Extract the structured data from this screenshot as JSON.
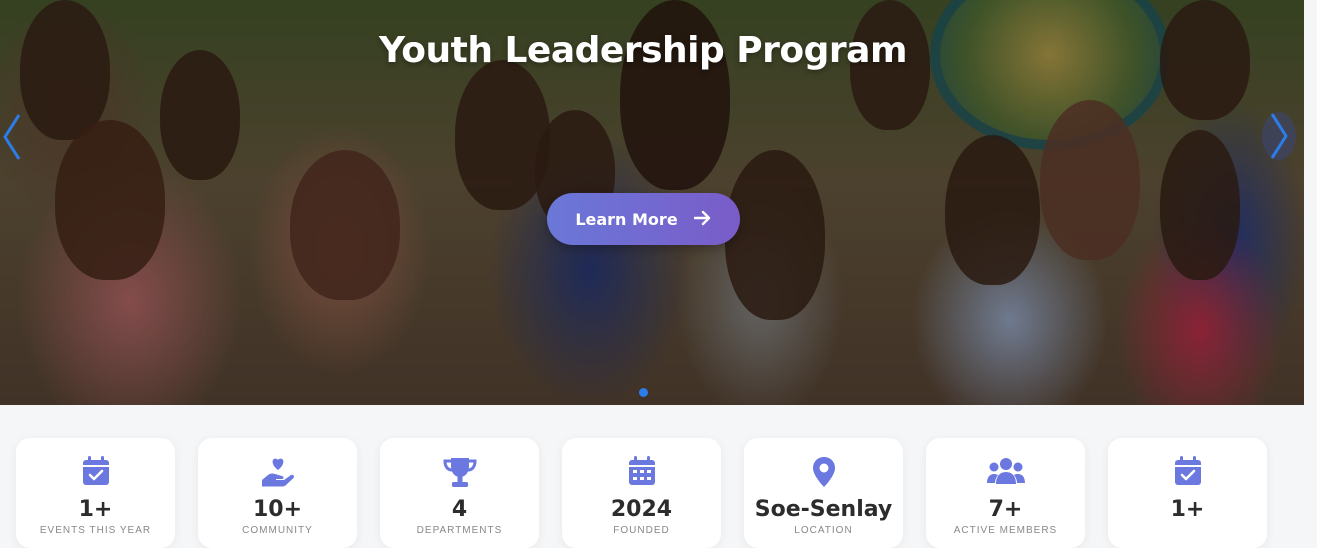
{
  "hero": {
    "title": "Youth Leadership Program",
    "cta_label": "Learn More",
    "accent": "#6a78d8",
    "dot_color": "#2b7de9"
  },
  "stats": [
    {
      "icon": "calendar-check-icon",
      "value": "1+",
      "label": "Events This Year"
    },
    {
      "icon": "hand-heart-icon",
      "value": "10+",
      "label": "Community"
    },
    {
      "icon": "trophy-icon",
      "value": "4",
      "label": "Departments"
    },
    {
      "icon": "calendar-icon",
      "value": "2024",
      "label": "Founded"
    },
    {
      "icon": "map-pin-icon",
      "value": "Soe-Senlay",
      "label": "Location"
    },
    {
      "icon": "users-icon",
      "value": "7+",
      "label": "Active Members"
    },
    {
      "icon": "calendar-check-icon",
      "value": "1+",
      "label": ""
    }
  ],
  "icon_color": "#6a78e0"
}
